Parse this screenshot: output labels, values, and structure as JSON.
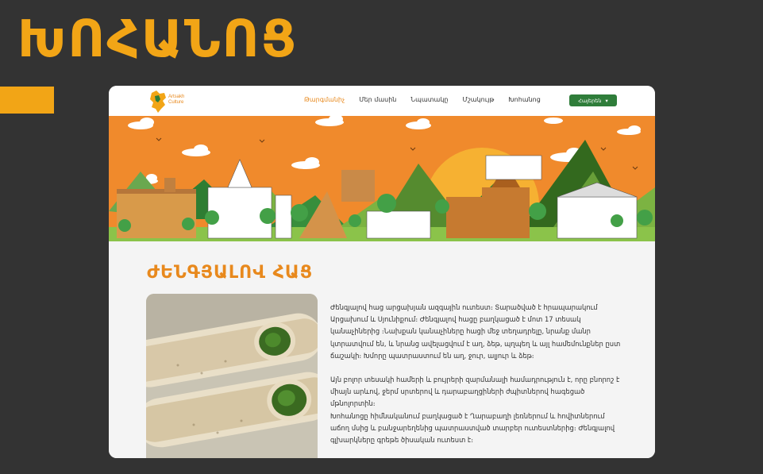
{
  "heading": "ԽՈՀԱՆՈՑ",
  "colors": {
    "accent": "#F2A516",
    "orange": "#E8891D",
    "green": "#2F7D3A",
    "background": "#333333"
  },
  "site": {
    "logo_line1": "Artsakh",
    "logo_line2": "Culture",
    "nav": [
      {
        "label": "Թարգմանիչ",
        "active": true
      },
      {
        "label": "Մեր մասին",
        "active": false
      },
      {
        "label": "Նպատակը",
        "active": false
      },
      {
        "label": "Մշակույթ",
        "active": false
      },
      {
        "label": "Խոհանոց",
        "active": false
      }
    ],
    "language_button": "Հայերեն"
  },
  "article": {
    "title": "ԺԵՆԳՅԱԼՈՎ ՀԱՑ",
    "paragraph1": "Ժենգյալով հաց արցախյան ազգային ուտեստ։ Տարածված է հրապարակում Արցախում և Սյունիքում։ Ժենգյալով հացը բաղկացած է մոտ 17 տեսակ կանաչիներից ։Նախքան կանաչիները հացի մեջ տեղադրելը, նրանք մանր կտրատվում են, և նրանց ավելացվում է աղ, ձեթ, պղպեղ և այլ համեմունքներ ըստ ճաշակի։ Խմորը պատրաստում են աղ, ջուր, ալյուր և ձեթ։",
    "paragraph2": "Այն բոլոր տեսակի համերի և բույրերի զարմանալի համադրություն է, որը բնորոշ է միայն արևով, ջերմ սրտերով և դարաբաղցիների ժպիտներով հագեցած մթնոլորտին։",
    "paragraph3": "Խոհանոցը հիմնականում բաղկացած է Ղարաբաղի լեռներում և հովիտներում աճող մսից և բանջարեղենից պատրաստված տարբեր ուտեստներից։ Ժենգյալով գլխարկները գրեթե ծիսական ուտեստ է։"
  }
}
